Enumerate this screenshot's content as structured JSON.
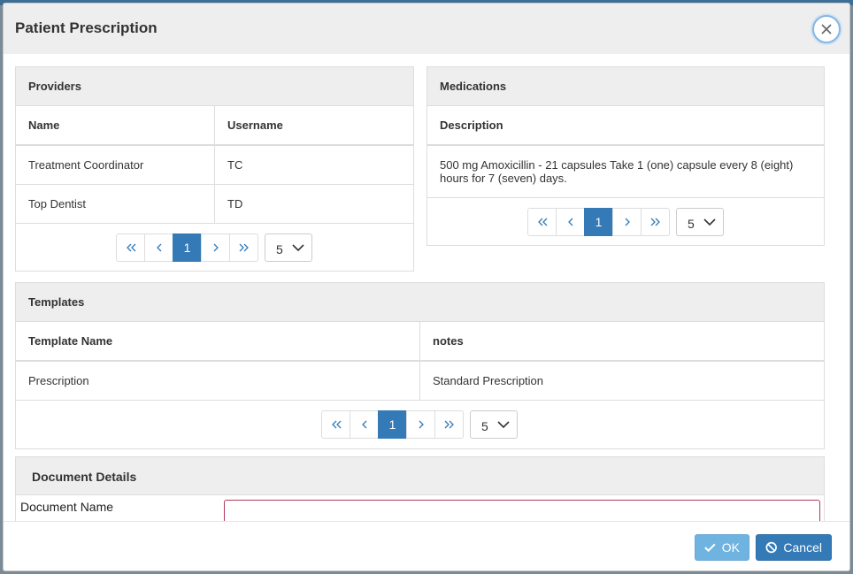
{
  "dialog": {
    "title": "Patient Prescription"
  },
  "providers": {
    "title": "Providers",
    "columns": [
      "Name",
      "Username"
    ],
    "rows": [
      [
        "Treatment Coordinator",
        "TC"
      ],
      [
        "Top Dentist",
        "TD"
      ]
    ],
    "page": "1",
    "page_size": "5"
  },
  "medications": {
    "title": "Medications",
    "columns": [
      "Description"
    ],
    "rows": [
      [
        "500 mg Amoxicillin - 21 capsules Take 1 (one) capsule every 8 (eight) hours for 7 (seven) days."
      ]
    ],
    "page": "1",
    "page_size": "5"
  },
  "templates": {
    "title": "Templates",
    "columns": [
      "Template Name",
      "notes"
    ],
    "rows": [
      [
        "Prescription",
        "Standard Prescription"
      ]
    ],
    "page": "1",
    "page_size": "5"
  },
  "document_details": {
    "title": "Document Details",
    "name_label": "Document Name",
    "name_value": ""
  },
  "footer": {
    "ok_label": "OK",
    "cancel_label": "Cancel"
  },
  "icons": {
    "close": "close-icon",
    "first": "double-chevron-left-icon",
    "prev": "chevron-left-icon",
    "next": "chevron-right-icon",
    "last": "double-chevron-right-icon",
    "select": "chevron-down-icon",
    "ok": "check-icon",
    "cancel": "ban-icon"
  },
  "colors": {
    "primary": "#337ab7",
    "ok_disabled": "#6fb3e0",
    "header_bg": "#eeeeee",
    "invalid_border": "#b03a5a"
  }
}
